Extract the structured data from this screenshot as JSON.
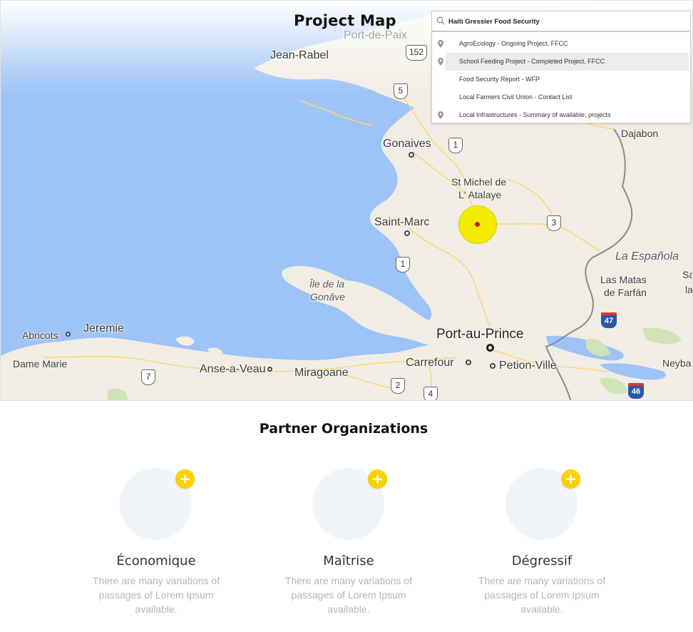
{
  "map": {
    "title": "Project Map",
    "labels": {
      "port_de_paix": "Port-de-Paix",
      "jean_rabel": "Jean-Rabel",
      "gonaives": "Gonaives",
      "st_michel_1": "St Michel de",
      "st_michel_2": "L' Atalaye",
      "saint_marc": "Saint-Marc",
      "ile_gonave_1": "Île de la",
      "ile_gonave_2": "Gonâve",
      "la_espanola": "La Española",
      "las_matas_1": "Las Matas",
      "las_matas_2": "de Farfán",
      "dajabon": "Dajabon",
      "sa": "Sa",
      "la": "la",
      "abricots": "Abricots",
      "jeremie": "Jeremie",
      "dame_marie": "Dame Marie",
      "anse_a_veau": "Anse-a-Veau",
      "miragoane": "Miragoane",
      "port_au_prince": "Port-au-Prince",
      "carrefour": "Carrefour",
      "petion_ville": "Petion-Ville",
      "neyba": "Neyba"
    },
    "shields": {
      "r152": "152",
      "r5": "5",
      "r1a": "1",
      "r3": "3",
      "r1b": "1",
      "r7": "7",
      "r2": "2",
      "r4": "4",
      "i47": "47",
      "i46": "46"
    }
  },
  "search": {
    "value": "Haiti Gressier Food Security",
    "results": [
      {
        "label": "AgroEcology - Ongoing Project, FFCC",
        "has_pin": true,
        "active": false
      },
      {
        "label": "School Feeding Project - Completed Project, FFCC",
        "has_pin": true,
        "active": true
      },
      {
        "label": "Food Security Report - WFP",
        "has_pin": false,
        "active": false
      },
      {
        "label": "Local Farmers Civil Union - Contact List",
        "has_pin": false,
        "active": false
      },
      {
        "label": "Local Infrastructures - Summary of available, projects",
        "has_pin": true,
        "active": false
      }
    ]
  },
  "partners": {
    "title": "Partner Organizations",
    "items": [
      {
        "name": "Économique",
        "description": "There are many variations of passages of Lorem Ipsum available.",
        "icon": "plus-icon"
      },
      {
        "name": "Maîtrise",
        "description": "There are many variations of passages of Lorem Ipsum available.",
        "icon": "plus-icon"
      },
      {
        "name": "Dégressif",
        "description": "There are many variations of passages of Lorem Ipsum available.",
        "icon": "plus-icon"
      }
    ]
  },
  "colors": {
    "water": "#9dc3f7",
    "land": "#f1ede4",
    "accent_yellow": "#fcd100",
    "marker_halo": "#f3ec00",
    "marker_dot": "#cc1d1d"
  }
}
